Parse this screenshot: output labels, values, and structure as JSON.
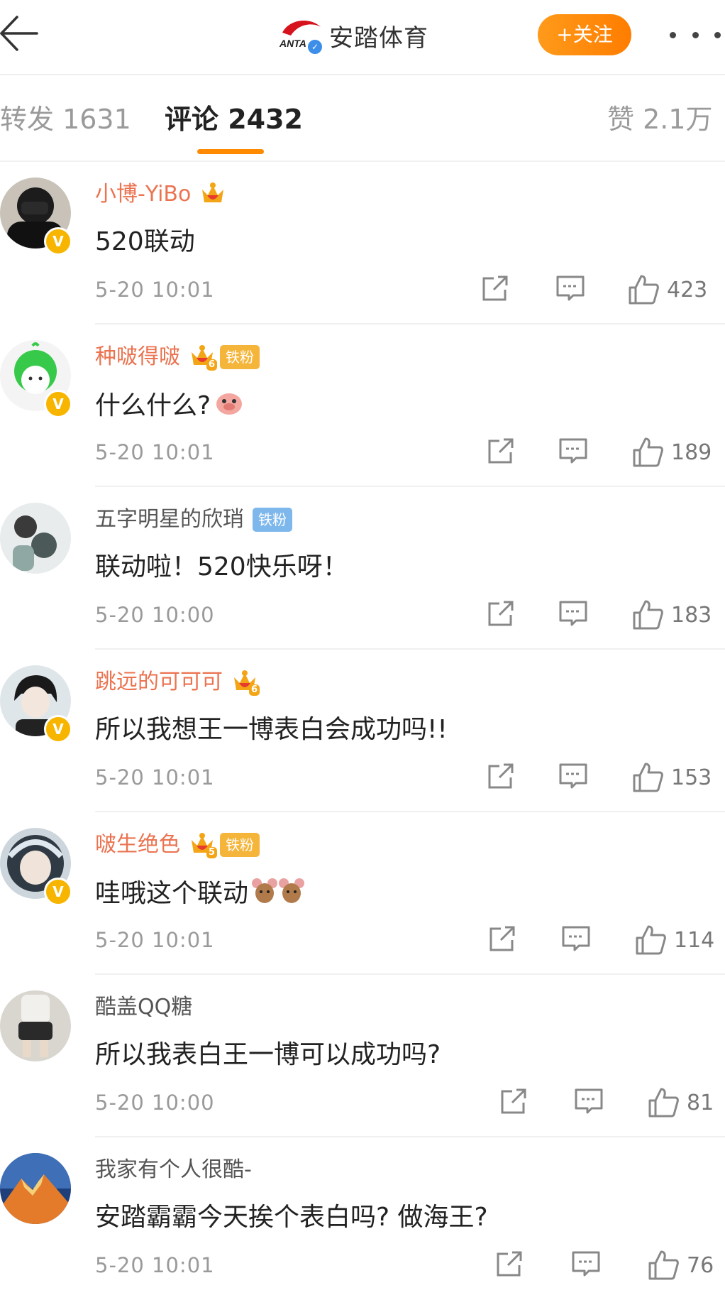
{
  "header": {
    "back_icon": "arrow-left-icon",
    "brand_logo_text": "ANTA",
    "title": "安踏体育",
    "follow_label": "+关注",
    "more_icon": "ellipsis-icon",
    "accent": "#ff8a00"
  },
  "tabs": {
    "repost": "转发 1631",
    "comments": "评论 2432",
    "likes": "赞 2.1万",
    "active": "comments"
  },
  "comments": [
    {
      "username": "小博-YiBo",
      "vip": true,
      "crown_level": "",
      "fan_badge": "",
      "verified": true,
      "text": "520联动",
      "time": "5-20 10:01",
      "likes": "423"
    },
    {
      "username": "种啵得啵",
      "vip": true,
      "crown_level": "6",
      "fan_badge": "铁粉",
      "verified": true,
      "text": "什么什么?",
      "emoji": "pig-emoji",
      "time": "5-20 10:01",
      "likes": "189"
    },
    {
      "username": "五字明星的欣琑",
      "vip": false,
      "fan_badge": "铁粉",
      "verified": false,
      "text": "联动啦！520快乐呀！",
      "time": "5-20 10:00",
      "likes": "183"
    },
    {
      "username": "跳远的可可可",
      "vip": true,
      "crown_level": "6",
      "fan_badge": "",
      "verified": true,
      "text": "所以我想王一博表白会成功吗!!",
      "time": "5-20 10:01",
      "likes": "153"
    },
    {
      "username": "啵生绝色",
      "vip": true,
      "crown_level": "5",
      "fan_badge": "铁粉",
      "verified": true,
      "text": "哇哦这个联动",
      "emoji": "jerry-mouse-emoji",
      "time": "5-20 10:01",
      "likes": "114"
    },
    {
      "username": "酷盖QQ糖",
      "vip": false,
      "fan_badge": "",
      "verified": false,
      "text": "所以我表白王一博可以成功吗?",
      "time": "5-20 10:00",
      "likes": "81"
    },
    {
      "username": "我家有个人很酷-",
      "vip": false,
      "fan_badge": "",
      "verified": false,
      "text": "安踏霸霸今天挨个表白吗? 做海王?",
      "time": "5-20 10:01",
      "likes": "76"
    }
  ],
  "icons": {
    "share": "share-icon",
    "comment": "comment-icon",
    "like": "thumbs-up-icon",
    "verified": "verified-v-icon",
    "crown": "crown-icon"
  }
}
